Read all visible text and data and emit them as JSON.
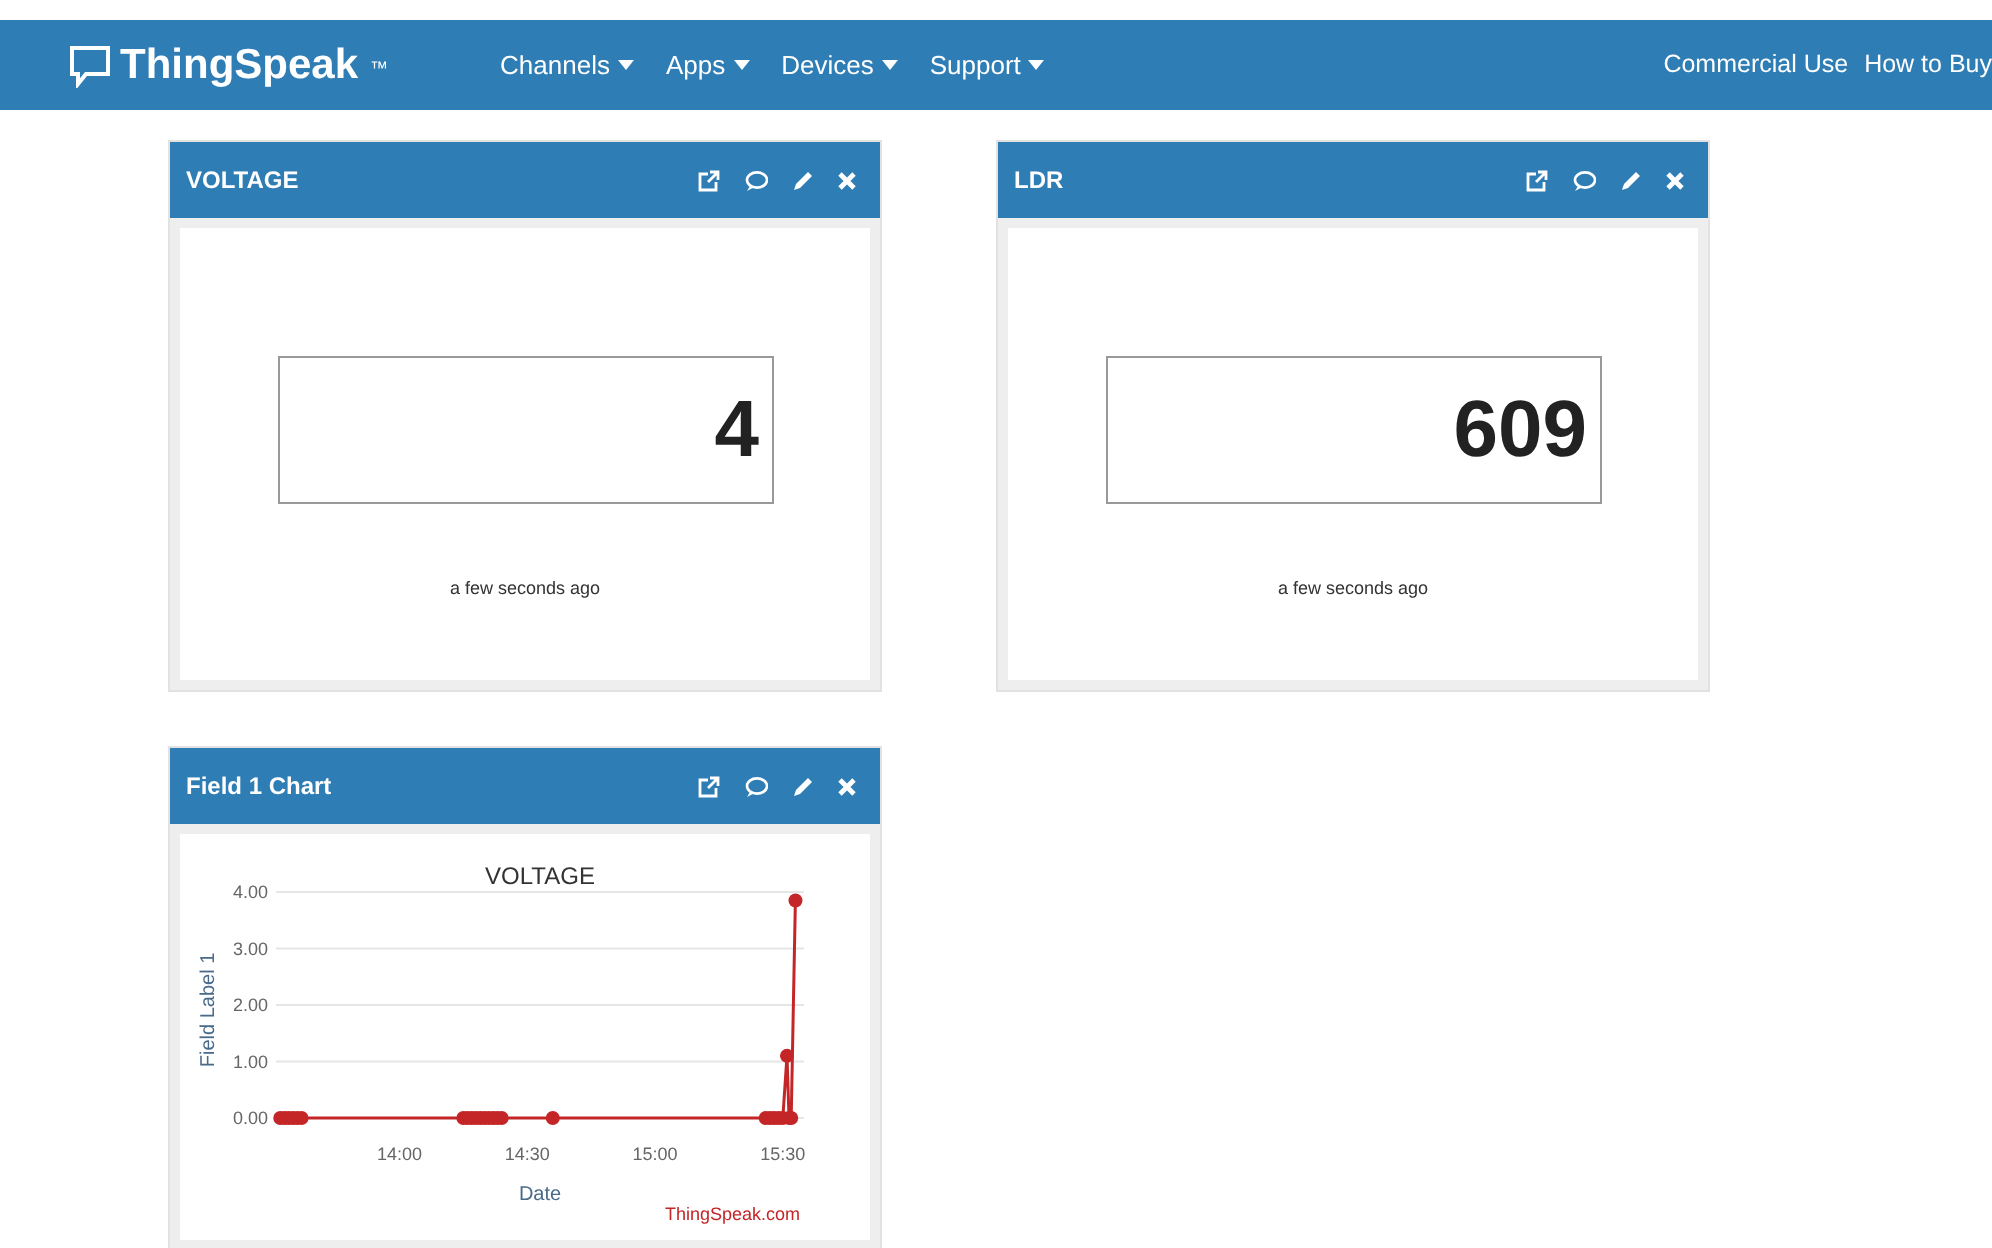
{
  "navbar": {
    "brand": "ThingSpeak",
    "trademark": "™",
    "menus": [
      {
        "label": "Channels"
      },
      {
        "label": "Apps"
      },
      {
        "label": "Devices"
      },
      {
        "label": "Support"
      }
    ],
    "right_links": [
      "Commercial Use",
      "How to Buy"
    ]
  },
  "widgets": [
    {
      "kind": "numeric",
      "title": "VOLTAGE",
      "value": "4",
      "updated": "a few seconds ago"
    },
    {
      "kind": "numeric",
      "title": "LDR",
      "value": "609",
      "updated": "a few seconds ago"
    },
    {
      "kind": "chart",
      "title": "Field 1 Chart",
      "credit": "ThingSpeak.com",
      "chart_data": {
        "type": "line",
        "title": "VOLTAGE",
        "xlabel": "Date",
        "ylabel": "Field Label 1",
        "x": [
          812,
          813,
          814,
          815,
          816,
          817,
          855,
          856,
          857,
          858,
          859,
          860,
          861,
          862,
          863,
          864,
          876,
          926,
          927,
          928,
          929,
          930,
          931,
          931.5,
          932,
          933
        ],
        "grid": true,
        "series": [
          {
            "color": "#c42627",
            "marker": "circle",
            "values": [
              0,
              0,
              0,
              0,
              0,
              0,
              0,
              0,
              0,
              0,
              0,
              0,
              0,
              0,
              0,
              0,
              0,
              0,
              0,
              0,
              0,
              0,
              1.1,
              0,
              0,
              3.85
            ]
          }
        ],
        "xlim": [
          811,
          935
        ],
        "ylim": [
          0,
          4
        ],
        "xticks": [
          {
            "value": 840,
            "label": "14:00"
          },
          {
            "value": 870,
            "label": "14:30"
          },
          {
            "value": 900,
            "label": "15:00"
          },
          {
            "value": 930,
            "label": "15:30"
          }
        ],
        "yticks": [
          {
            "value": 0,
            "label": "0.00"
          },
          {
            "value": 1,
            "label": "1.00"
          },
          {
            "value": 2,
            "label": "2.00"
          },
          {
            "value": 3,
            "label": "3.00"
          },
          {
            "value": 4,
            "label": "4.00"
          }
        ]
      }
    }
  ]
}
